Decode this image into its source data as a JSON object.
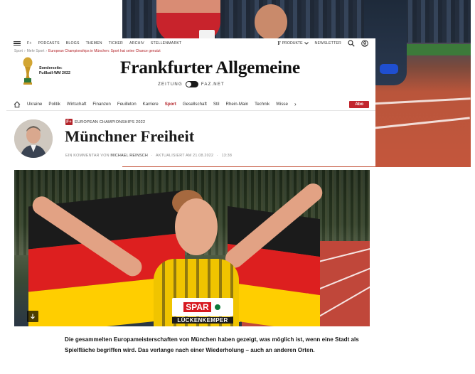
{
  "topnav": {
    "links": [
      "F+",
      "PODCASTS",
      "BLOGS",
      "THEMEN",
      "TICKER",
      "ARCHIV",
      "STELLENMARKT"
    ],
    "produkte": "PRODUKTE",
    "newsletter": "NEWSLETTER",
    "icons": [
      "menu-icon",
      "search-icon",
      "user-icon"
    ]
  },
  "breadcrumb": {
    "items": [
      "Sport",
      "Mehr Sport",
      "European Championships in München: Sport hat seine Chance genutzt"
    ]
  },
  "promo": {
    "label": "Sonderseite:",
    "title": "Fußball-WM 2022"
  },
  "logo": {
    "name": "Frankfurter Allgemeine",
    "zeitung": "ZEITUNG",
    "faznet": "FAZ.NET"
  },
  "sections": {
    "items": [
      "Ukraine",
      "Politik",
      "Wirtschaft",
      "Finanzen",
      "Feuilleton",
      "Karriere",
      "Sport",
      "Gesellschaft",
      "Stil",
      "Rhein-Main",
      "Technik",
      "Wisse"
    ],
    "active": "Sport",
    "more": "›",
    "abo": "Abo"
  },
  "article": {
    "kicker_badge": "F+",
    "kicker": "EUROPEAN CHAMPIONSHIPS 2022",
    "headline": "Münchner Freiheit",
    "byline_prefix": "EIN KOMMENTAR VON",
    "author": "MICHAEL REINSCH",
    "updated": "AKTUALISIERT AM 21.08.2022",
    "time": "13:38",
    "bib_sponsor": "SPAR",
    "bib_name": "LÜCKENKEMPER",
    "teaser": "Die gesammelten Europameisterschaften von München haben gezeigt, was möglich ist, wenn eine Stadt als Spielfläche begriffen wird. Das verlange nach einer Wiederholung – auch an anderen Orten."
  },
  "colors": {
    "accent": "#b3242a",
    "abo": "#c2262e"
  }
}
